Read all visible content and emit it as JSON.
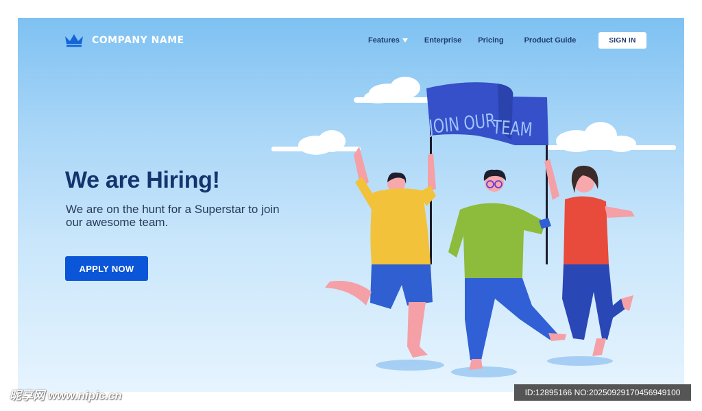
{
  "header": {
    "logo_text": "COMPANY NAME",
    "nav": {
      "features": "Features",
      "enterprise": "Enterprise",
      "pricing": "Pricing",
      "product_guide": "Product Guide"
    },
    "sign_in": "SIGN IN"
  },
  "hero": {
    "title": "We are Hiring!",
    "subtitle": "We are on the hunt for a Superstar to join our awesome team.",
    "cta": "APPLY NOW"
  },
  "illustration": {
    "flag_line1": "JOIN OUR",
    "flag_line2": "TEAM"
  },
  "watermark": {
    "left": "昵享网 www.nipic.cn",
    "right": "ID:12895166 NO:20250929170456949100"
  },
  "colors": {
    "background_top": "#7ec1f2",
    "background_bottom": "#e6f4fe",
    "title": "#14346d",
    "cta": "#0b55d9",
    "flag": "#3550c8",
    "logo_icon": "#1565d8"
  },
  "icons": {
    "logo": "crown-icon",
    "features_dropdown": "caret-down-icon"
  }
}
